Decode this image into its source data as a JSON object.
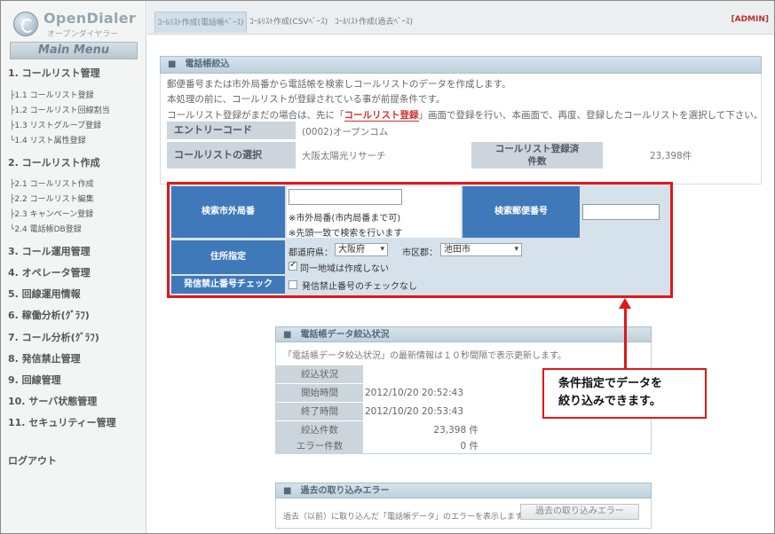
{
  "app": {
    "logo_title": "OpenDialer",
    "logo_sub": "オープンダイヤラー",
    "main_menu": "Main Menu",
    "admin": "[ADMIN]"
  },
  "sidebar": {
    "m1": "1. コールリスト管理",
    "m1_1": "├1.1 コールリスト登録",
    "m1_2": "├1.2 コールリスト回線割当",
    "m1_3": "├1.3 リストグループ登録",
    "m1_4": "└1.4 リスト属性登録",
    "m2": "2. コールリスト作成",
    "m2_1": "├2.1 コールリスト作成",
    "m2_2": "├2.2 コールリスト編集",
    "m2_3": "├2.3 キャンペーン登録",
    "m2_4": "└2.4 電話帳DB登録",
    "m3": "3. コール運用管理",
    "m4": "4. オペレータ管理",
    "m5": "5. 回線運用情報",
    "m6": "6. 稼働分析(ｸﾞﾗﾌ)",
    "m7": "7. コール分析(ｸﾞﾗﾌ)",
    "m8": "8. 発信禁止管理",
    "m9": "9. 回線管理",
    "m10": "10. サーバ状態管理",
    "m11": "11. セキュリティー管理",
    "logout": "ログアウト"
  },
  "tabs": {
    "t1": "ｺｰﾙﾘｽﾄ作成(電話帳ﾍﾞｰｽ)",
    "t2": "ｺｰﾙﾘｽﾄ作成(CSVﾍﾞｰｽ)",
    "t3": "ｺｰﾙﾘｽﾄ作成(過去ﾍﾞｰｽ)"
  },
  "main": {
    "header": "■　電話帳絞込",
    "info1": "郵便番号または市外局番から電話帳を検索しコールリストのデータを作成します。",
    "info2": "本処理の前に、コールリストが登録されている事が前提条件です。",
    "info3_a": "コールリスト登録がまだの場合は、先に「",
    "info3_link": "コールリスト登録",
    "info3_b": "」画面で登録を行い、本画面で、再度、登録したコールリストを選択して下さい。",
    "entry_label": "エントリーコード",
    "entry_value": "(0002)オープンコム",
    "list_label": "コールリストの選択",
    "list_value": "大阪太陽光リサーチ",
    "registered_label_1": "コールリスト登録済",
    "registered_label_2": "件数",
    "registered_value": "23,398件"
  },
  "search": {
    "area_code_label": "検索市外局番",
    "area_code_value": "",
    "note1": "※市外局番(市内局番まで可)",
    "note2": "※先頭一致で検索を行います",
    "zip_label": "検索郵便番号",
    "zip_value": "",
    "address_label": "住所指定",
    "pref_label": "都道府県：",
    "pref_value": "大阪府",
    "city_label": "市区郡：",
    "city_value": "池田市",
    "same_area": "同一地域は作成しない",
    "nocall_label": "発信禁止番号チェック",
    "nocall_option": "発信禁止番号のチェックなし"
  },
  "status": {
    "header": "■　電話帳データ絞込状況",
    "note": "「電話帳データ絞込状況」の最新情報は１０秒間隔で表示更新します。",
    "state_label": "絞込状況",
    "state_value": "",
    "start_label": "開始時間",
    "start_value": "2012/10/20 20:52:43",
    "end_label": "終了時間",
    "end_value": "2012/10/20 20:53:43",
    "count_label": "絞込件数",
    "count_value": "23,398 件",
    "error_label": "エラー件数",
    "error_value": "0 件"
  },
  "callout": {
    "line1": "条件指定でデータを",
    "line2": "絞り込みできます。"
  },
  "errors": {
    "header": "■　過去の取り込みエラー",
    "note": "過去（以前）に取り込んだ「電話帳データ」のエラーを表示します。",
    "button": "過去の取り込みエラー"
  }
}
